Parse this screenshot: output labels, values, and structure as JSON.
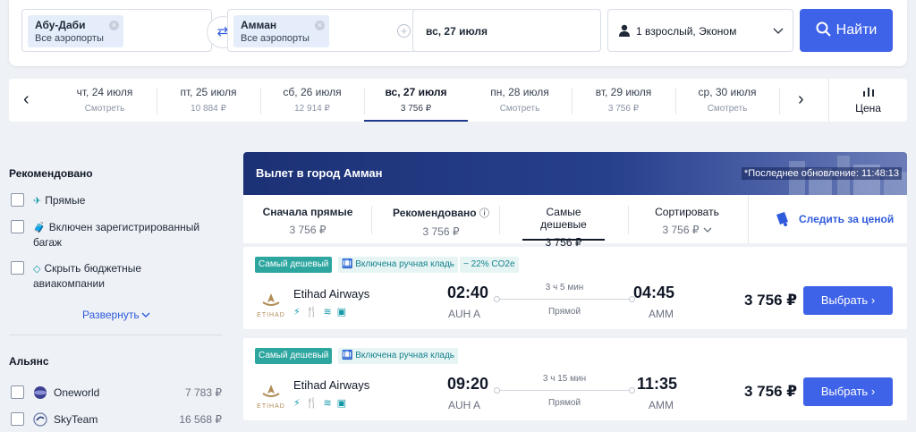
{
  "search": {
    "from_city": "Абу-Даби",
    "from_sub": "Все аэропорты",
    "to_city": "Амман",
    "to_sub": "Все аэропорты",
    "date": "вс, 27 июля",
    "passengers": "1 взрослый, Эконом",
    "find_label": "Найти"
  },
  "dates": [
    {
      "day": "чт, 24 июля",
      "price": "Смотреть"
    },
    {
      "day": "пт, 25 июля",
      "price": "10 884 ₽"
    },
    {
      "day": "сб, 26 июля",
      "price": "12 914 ₽"
    },
    {
      "day": "вс, 27 июля",
      "price": "3 756 ₽"
    },
    {
      "day": "пн, 28 июля",
      "price": "Смотреть"
    },
    {
      "day": "вт, 29 июля",
      "price": "3 756 ₽"
    },
    {
      "day": "ср, 30 июля",
      "price": "Смотреть"
    }
  ],
  "price_filter_label": "Цена",
  "sidebar": {
    "recommended_title": "Рекомендовано",
    "options": [
      "Прямые",
      "Включен зарегистрированный багаж",
      "Скрыть бюджетные авиакомпании"
    ],
    "expand_label": "Развернуть",
    "alliance_title": "Альянс",
    "alliances": [
      {
        "name": "Oneworld",
        "price": "7 783 ₽"
      },
      {
        "name": "SkyTeam",
        "price": "16 568 ₽"
      }
    ]
  },
  "results": {
    "header_title": "Вылет в город Амман",
    "last_update": "*Последнее обновление: 11:48:13",
    "sort": [
      {
        "label": "Сначала прямые",
        "value": "3 756 ₽"
      },
      {
        "label": "Рекомендовано",
        "value": "3 756 ₽"
      },
      {
        "label": "Самые дешевые",
        "value": "3 756 ₽"
      },
      {
        "label": "Сортировать",
        "value": "3 756 ₽"
      }
    ],
    "follow_price": "Следить за ценой",
    "flights": [
      {
        "tags": [
          "Самый дешевый",
          "Включена ручная кладь",
          "− 22% CO2e"
        ],
        "airline": "Etihad Airways",
        "logo_text": "ETIHAD",
        "dep_time": "02:40",
        "dep_airport": "AUH A",
        "duration": "3 ч 5 мин",
        "stops": "Прямой",
        "arr_time": "04:45",
        "arr_airport": "AMM",
        "price": "3 756 ₽",
        "select_label": "Выбрать"
      },
      {
        "tags": [
          "Самый дешевый",
          "Включена ручная кладь"
        ],
        "airline": "Etihad Airways",
        "logo_text": "ETIHAD",
        "dep_time": "09:20",
        "dep_airport": "AUH A",
        "duration": "3 ч 15 мин",
        "stops": "Прямой",
        "arr_time": "11:35",
        "arr_airport": "AMM",
        "price": "3 756 ₽",
        "select_label": "Выбрать"
      }
    ]
  },
  "colors": {
    "accent": "#3e62e8",
    "teal": "#2ea6a0",
    "header": "#1c3175"
  }
}
